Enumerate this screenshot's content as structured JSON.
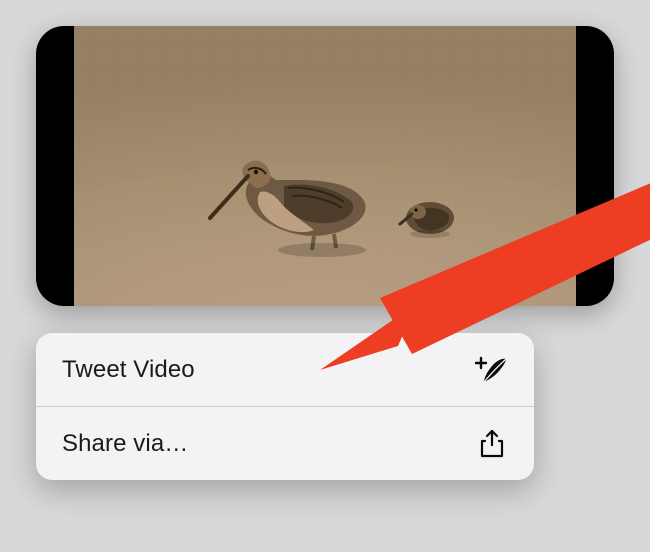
{
  "video": {
    "alt": "Two birds on sand"
  },
  "menu": {
    "items": [
      {
        "label": "Tweet Video",
        "icon": "plus-feather-icon"
      },
      {
        "label": "Share via…",
        "icon": "share-icon"
      }
    ]
  },
  "annotation": {
    "color": "#ed3d23"
  }
}
